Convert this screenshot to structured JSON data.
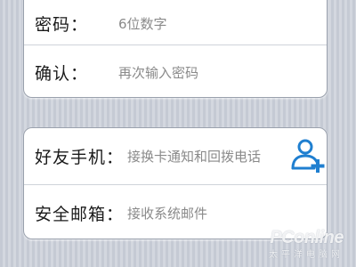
{
  "account_group": {
    "rows": [
      {
        "label": "密码：",
        "placeholder": "6位数字"
      },
      {
        "label": "确认：",
        "placeholder": "再次输入密码"
      }
    ]
  },
  "contact_group": {
    "rows": [
      {
        "label": "好友手机：",
        "placeholder": "接换卡通知和回拨电话"
      },
      {
        "label": "安全邮箱：",
        "placeholder": "接收系统邮件"
      }
    ],
    "add_contact_icon": "add-contact-icon"
  },
  "watermark": {
    "logo": "PConline",
    "subtitle": "太平洋电脑网"
  },
  "colors": {
    "icon_blue": "#1f7fd0",
    "placeholder": "#8a8a8a",
    "background": "#c9ced8"
  }
}
